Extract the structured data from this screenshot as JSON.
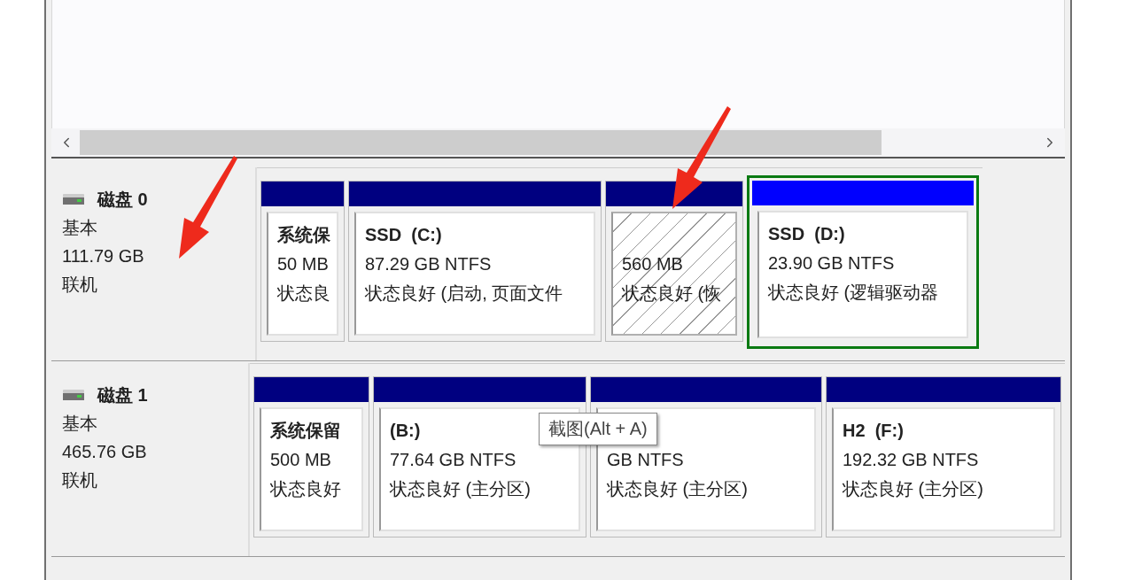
{
  "disks": [
    {
      "name": "磁盘 0",
      "type": "基本",
      "size": "111.79 GB",
      "status": "联机",
      "partitions": [
        {
          "title": "系统保",
          "size": "50 MB",
          "status": "状态良",
          "selected": false,
          "hatched": false
        },
        {
          "title": "SSD  (C:)",
          "size": "87.29 GB NTFS",
          "status": "状态良好 (启动, 页面文件",
          "selected": false,
          "hatched": false
        },
        {
          "size": "560 MB",
          "status": "状态良好 (恢",
          "selected": false,
          "hatched": true
        },
        {
          "title": "SSD  (D:)",
          "size": "23.90 GB NTFS",
          "status": "状态良好 (逻辑驱动器",
          "selected": true,
          "hatched": false
        }
      ]
    },
    {
      "name": "磁盘 1",
      "type": "基本",
      "size": "465.76 GB",
      "status": "联机",
      "partitions": [
        {
          "title": "系统保留",
          "size": "500 MB",
          "status": "状态良好",
          "selected": false,
          "hatched": false
        },
        {
          "title": "(B:)",
          "size": "77.64 GB NTFS",
          "status": "状态良好 (主分区)",
          "selected": false,
          "hatched": false
        },
        {
          "size": "GB NTFS",
          "status": "状态良好 (主分区)",
          "selected": false,
          "hatched": false
        },
        {
          "title": "H2  (F:)",
          "size": "192.32 GB NTFS",
          "status": "状态良好 (主分区)",
          "selected": false,
          "hatched": false
        }
      ]
    }
  ],
  "tooltip": {
    "text": "截图(Alt + A)"
  },
  "annotations": [
    {
      "kind": "arrow"
    },
    {
      "kind": "arrow"
    }
  ]
}
